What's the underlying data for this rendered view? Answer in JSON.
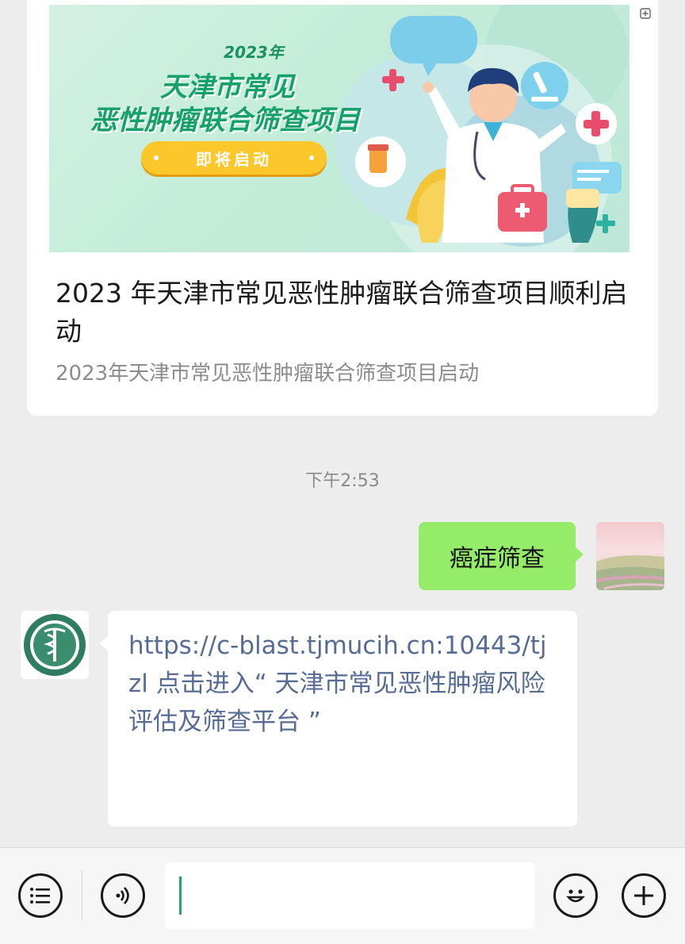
{
  "article": {
    "banner": {
      "year": "2023年",
      "title_line1": "天津市常见",
      "title_line2": "恶性肿瘤联合筛查项目",
      "button": "即将启动"
    },
    "title": "2023 年天津市常见恶性肿瘤联合筛查项目顺利启动",
    "subtitle": "2023年天津市常见恶性肿瘤联合筛查项目启动"
  },
  "chat": {
    "timestamp": "下午2:53",
    "outgoing_message": "癌症筛查",
    "incoming_message": "https://c-blast.tjmucih.cn:10443/tjzl 点击进入“ 天津市常见恶性肿瘤风险评估及筛查平台 ”"
  },
  "input_bar": {
    "left_icon": "menu-list-icon",
    "voice_icon": "voice-icon",
    "emoji_icon": "emoji-icon",
    "plus_icon": "plus-icon",
    "value": ""
  },
  "colors": {
    "outgoing_bubble": "#95ec69",
    "link": "#576b95",
    "caret": "#1aad5f",
    "banner_green": "#16a06a",
    "banner_pill": "#fbc72b"
  }
}
